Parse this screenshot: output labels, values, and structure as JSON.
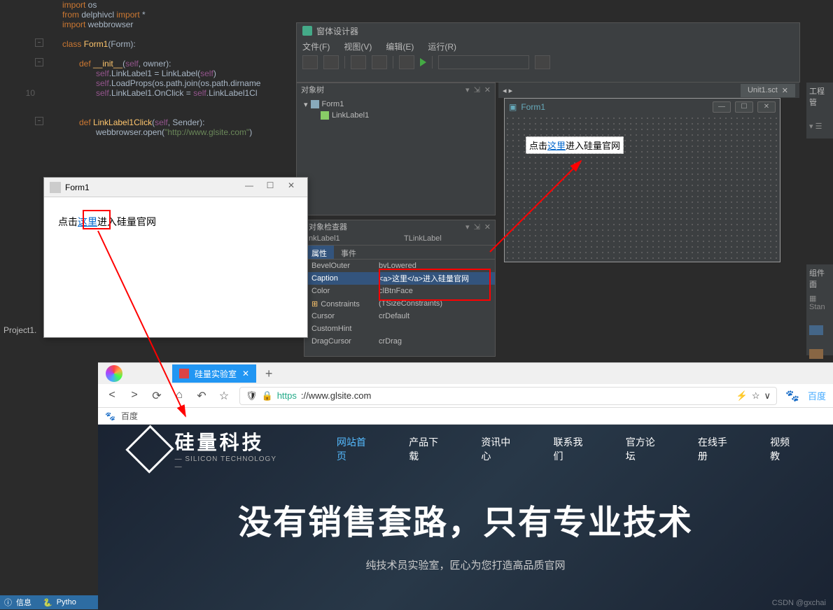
{
  "editor": {
    "line_number": "10",
    "code_lines": [
      {
        "indent": 1,
        "parts": [
          {
            "t": "import",
            "c": "kw"
          },
          {
            "t": " os"
          }
        ]
      },
      {
        "indent": 1,
        "parts": [
          {
            "t": "from",
            "c": "kw"
          },
          {
            "t": " delphivcl "
          },
          {
            "t": "import",
            "c": "kw"
          },
          {
            "t": " *"
          }
        ]
      },
      {
        "indent": 1,
        "parts": [
          {
            "t": "import",
            "c": "kw"
          },
          {
            "t": " webbrowser"
          }
        ]
      },
      {
        "indent": 0,
        "parts": [
          {
            "t": ""
          }
        ]
      },
      {
        "indent": 1,
        "parts": [
          {
            "t": "class ",
            "c": "kw"
          },
          {
            "t": "Form1",
            "c": "fn"
          },
          {
            "t": "(Form):"
          }
        ]
      },
      {
        "indent": 0,
        "parts": [
          {
            "t": ""
          }
        ]
      },
      {
        "indent": 2,
        "parts": [
          {
            "t": "def ",
            "c": "kw"
          },
          {
            "t": "__init__",
            "c": "fn"
          },
          {
            "t": "("
          },
          {
            "t": "self",
            "c": "self"
          },
          {
            "t": ", owner):"
          }
        ]
      },
      {
        "indent": 3,
        "parts": [
          {
            "t": "self",
            "c": "self"
          },
          {
            "t": ".LinkLabel1 = LinkLabel("
          },
          {
            "t": "self",
            "c": "self"
          },
          {
            "t": ")"
          }
        ]
      },
      {
        "indent": 3,
        "parts": [
          {
            "t": "self",
            "c": "self"
          },
          {
            "t": ".LoadProps(os.path.join(os.path.dirname"
          }
        ]
      },
      {
        "indent": 3,
        "parts": [
          {
            "t": "self",
            "c": "self"
          },
          {
            "t": ".LinkLabel1.OnClick = "
          },
          {
            "t": "self",
            "c": "self"
          },
          {
            "t": ".LinkLabel1Cl"
          }
        ]
      },
      {
        "indent": 0,
        "parts": [
          {
            "t": ""
          }
        ]
      },
      {
        "indent": 0,
        "parts": [
          {
            "t": ""
          }
        ]
      },
      {
        "indent": 2,
        "parts": [
          {
            "t": "def ",
            "c": "kw"
          },
          {
            "t": "LinkLabel1Click",
            "c": "fn"
          },
          {
            "t": "("
          },
          {
            "t": "self",
            "c": "self"
          },
          {
            "t": ", Sender):"
          }
        ]
      },
      {
        "indent": 3,
        "parts": [
          {
            "t": "webbrowser.open("
          },
          {
            "t": "\"http://www.glsite.com\"",
            "c": "str"
          },
          {
            "t": ")"
          }
        ]
      }
    ]
  },
  "project": {
    "label": "Project1."
  },
  "form1": {
    "title": "Form1",
    "text_before": "点击",
    "link": "这里",
    "text_after": "进入硅量官网",
    "min": "—",
    "max": "☐",
    "close": "✕"
  },
  "designer": {
    "title": "窗体设计器",
    "menu": [
      "文件(F)",
      "视图(V)",
      "编辑(E)",
      "运行(R)"
    ]
  },
  "canvas": {
    "tab": "Unit1.sct",
    "form_title": "Form1",
    "label_before": "点击",
    "label_link": "这里",
    "label_after": "进入硅量官网"
  },
  "objtree": {
    "title": "对象树",
    "root": "Form1",
    "child": "LinkLabel1"
  },
  "inspector": {
    "title": "对象检查器",
    "combo_name": "nkLabel1",
    "combo_type": "TLinkLabel",
    "tabs": [
      "属性",
      "事件"
    ],
    "props": [
      {
        "n": "BevelOuter",
        "v": "bvLowered"
      },
      {
        "n": "Caption",
        "v": "<a>这里</a>进入硅量官网",
        "sel": true
      },
      {
        "n": "Color",
        "v": "clBtnFace"
      },
      {
        "n": "Constraints",
        "v": "(TSizeConstraints)",
        "prefix": "⊞"
      },
      {
        "n": "Cursor",
        "v": "crDefault"
      },
      {
        "n": "CustomHint",
        "v": ""
      },
      {
        "n": "DragCursor",
        "v": "crDrag"
      }
    ]
  },
  "right": {
    "p1": "工程管",
    "p2_title": "组件面",
    "p2_item": "Stan"
  },
  "bottombar": {
    "label": "信息",
    "lang": "Pytho"
  },
  "browser": {
    "tab": "硅量实验室",
    "url_scheme": "https",
    "url_rest": "://www.glsite.com",
    "search": "百度",
    "bookmark": "百度"
  },
  "site": {
    "logo_cn": "硅量科技",
    "logo_en": "— SILICON TECHNOLOGY —",
    "nav": [
      "网站首页",
      "产品下载",
      "资讯中心",
      "联系我们",
      "官方论坛",
      "在线手册",
      "视频教"
    ],
    "hero": "没有销售套路，只有专业技术",
    "sub": "纯技术员实验室，匠心为您打造高品质官网",
    "watermark": "CSDN @gxchai"
  }
}
